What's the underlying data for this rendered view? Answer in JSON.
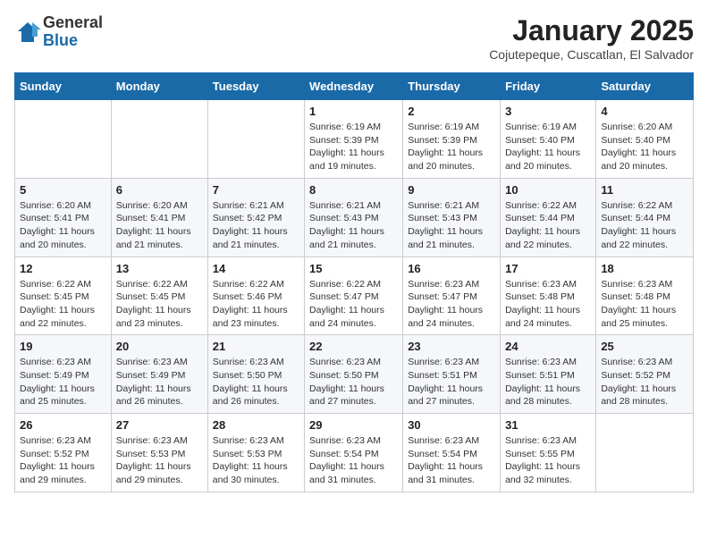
{
  "header": {
    "logo_general": "General",
    "logo_blue": "Blue",
    "month_title": "January 2025",
    "subtitle": "Cojutepeque, Cuscatlan, El Salvador"
  },
  "weekdays": [
    "Sunday",
    "Monday",
    "Tuesday",
    "Wednesday",
    "Thursday",
    "Friday",
    "Saturday"
  ],
  "weeks": [
    [
      {
        "day": "",
        "info": ""
      },
      {
        "day": "",
        "info": ""
      },
      {
        "day": "",
        "info": ""
      },
      {
        "day": "1",
        "info": "Sunrise: 6:19 AM\nSunset: 5:39 PM\nDaylight: 11 hours and 19 minutes."
      },
      {
        "day": "2",
        "info": "Sunrise: 6:19 AM\nSunset: 5:39 PM\nDaylight: 11 hours and 20 minutes."
      },
      {
        "day": "3",
        "info": "Sunrise: 6:19 AM\nSunset: 5:40 PM\nDaylight: 11 hours and 20 minutes."
      },
      {
        "day": "4",
        "info": "Sunrise: 6:20 AM\nSunset: 5:40 PM\nDaylight: 11 hours and 20 minutes."
      }
    ],
    [
      {
        "day": "5",
        "info": "Sunrise: 6:20 AM\nSunset: 5:41 PM\nDaylight: 11 hours and 20 minutes."
      },
      {
        "day": "6",
        "info": "Sunrise: 6:20 AM\nSunset: 5:41 PM\nDaylight: 11 hours and 21 minutes."
      },
      {
        "day": "7",
        "info": "Sunrise: 6:21 AM\nSunset: 5:42 PM\nDaylight: 11 hours and 21 minutes."
      },
      {
        "day": "8",
        "info": "Sunrise: 6:21 AM\nSunset: 5:43 PM\nDaylight: 11 hours and 21 minutes."
      },
      {
        "day": "9",
        "info": "Sunrise: 6:21 AM\nSunset: 5:43 PM\nDaylight: 11 hours and 21 minutes."
      },
      {
        "day": "10",
        "info": "Sunrise: 6:22 AM\nSunset: 5:44 PM\nDaylight: 11 hours and 22 minutes."
      },
      {
        "day": "11",
        "info": "Sunrise: 6:22 AM\nSunset: 5:44 PM\nDaylight: 11 hours and 22 minutes."
      }
    ],
    [
      {
        "day": "12",
        "info": "Sunrise: 6:22 AM\nSunset: 5:45 PM\nDaylight: 11 hours and 22 minutes."
      },
      {
        "day": "13",
        "info": "Sunrise: 6:22 AM\nSunset: 5:45 PM\nDaylight: 11 hours and 23 minutes."
      },
      {
        "day": "14",
        "info": "Sunrise: 6:22 AM\nSunset: 5:46 PM\nDaylight: 11 hours and 23 minutes."
      },
      {
        "day": "15",
        "info": "Sunrise: 6:22 AM\nSunset: 5:47 PM\nDaylight: 11 hours and 24 minutes."
      },
      {
        "day": "16",
        "info": "Sunrise: 6:23 AM\nSunset: 5:47 PM\nDaylight: 11 hours and 24 minutes."
      },
      {
        "day": "17",
        "info": "Sunrise: 6:23 AM\nSunset: 5:48 PM\nDaylight: 11 hours and 24 minutes."
      },
      {
        "day": "18",
        "info": "Sunrise: 6:23 AM\nSunset: 5:48 PM\nDaylight: 11 hours and 25 minutes."
      }
    ],
    [
      {
        "day": "19",
        "info": "Sunrise: 6:23 AM\nSunset: 5:49 PM\nDaylight: 11 hours and 25 minutes."
      },
      {
        "day": "20",
        "info": "Sunrise: 6:23 AM\nSunset: 5:49 PM\nDaylight: 11 hours and 26 minutes."
      },
      {
        "day": "21",
        "info": "Sunrise: 6:23 AM\nSunset: 5:50 PM\nDaylight: 11 hours and 26 minutes."
      },
      {
        "day": "22",
        "info": "Sunrise: 6:23 AM\nSunset: 5:50 PM\nDaylight: 11 hours and 27 minutes."
      },
      {
        "day": "23",
        "info": "Sunrise: 6:23 AM\nSunset: 5:51 PM\nDaylight: 11 hours and 27 minutes."
      },
      {
        "day": "24",
        "info": "Sunrise: 6:23 AM\nSunset: 5:51 PM\nDaylight: 11 hours and 28 minutes."
      },
      {
        "day": "25",
        "info": "Sunrise: 6:23 AM\nSunset: 5:52 PM\nDaylight: 11 hours and 28 minutes."
      }
    ],
    [
      {
        "day": "26",
        "info": "Sunrise: 6:23 AM\nSunset: 5:52 PM\nDaylight: 11 hours and 29 minutes."
      },
      {
        "day": "27",
        "info": "Sunrise: 6:23 AM\nSunset: 5:53 PM\nDaylight: 11 hours and 29 minutes."
      },
      {
        "day": "28",
        "info": "Sunrise: 6:23 AM\nSunset: 5:53 PM\nDaylight: 11 hours and 30 minutes."
      },
      {
        "day": "29",
        "info": "Sunrise: 6:23 AM\nSunset: 5:54 PM\nDaylight: 11 hours and 31 minutes."
      },
      {
        "day": "30",
        "info": "Sunrise: 6:23 AM\nSunset: 5:54 PM\nDaylight: 11 hours and 31 minutes."
      },
      {
        "day": "31",
        "info": "Sunrise: 6:23 AM\nSunset: 5:55 PM\nDaylight: 11 hours and 32 minutes."
      },
      {
        "day": "",
        "info": ""
      }
    ]
  ]
}
